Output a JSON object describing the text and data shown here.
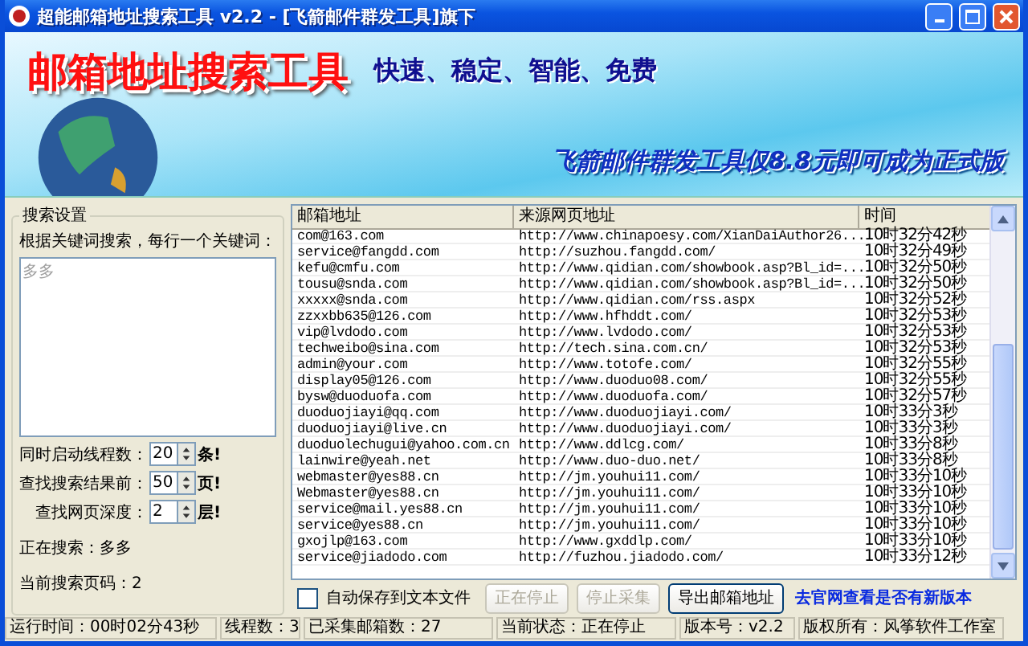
{
  "window": {
    "title": "超能邮箱地址搜索工具 v2.2 - [飞箭邮件群发工具]旗下"
  },
  "banner": {
    "title": "邮箱地址搜索工具",
    "slogan": "快速、稳定、智能、免费",
    "promo": "飞箭邮件群发工具仅8.8元即可成为正式版"
  },
  "search_settings": {
    "legend": "搜索设置",
    "keywords_label": "根据关键词搜索，每行一个关键词：",
    "keywords": "多多",
    "spinners": [
      {
        "label": "同时启动线程数：",
        "value": "20",
        "unit": "条!"
      },
      {
        "label": "查找搜索结果前：",
        "value": "50",
        "unit": "页!"
      },
      {
        "label": "查找网页深度：",
        "value": "2",
        "unit": "层!"
      }
    ],
    "searching": "正在搜索：多多",
    "current_page": "当前搜索页码：2"
  },
  "table": {
    "columns": [
      "邮箱地址",
      "来源网页地址",
      "时间"
    ],
    "rows": [
      [
        "com@163.com",
        "http://www.chinapoesy.com/XianDaiAuthor26...",
        "10时32分42秒"
      ],
      [
        "service@fangdd.com",
        "http://suzhou.fangdd.com/",
        "10时32分49秒"
      ],
      [
        "kefu@cmfu.com",
        "http://www.qidian.com/showbook.asp?Bl_id=...",
        "10时32分50秒"
      ],
      [
        "tousu@snda.com",
        "http://www.qidian.com/showbook.asp?Bl_id=...",
        "10时32分50秒"
      ],
      [
        "xxxxx@snda.com",
        "http://www.qidian.com/rss.aspx",
        "10时32分52秒"
      ],
      [
        "zzxxbb635@126.com",
        "http://www.hfhddt.com/",
        "10时32分53秒"
      ],
      [
        "vip@lvdodo.com",
        "http://www.lvdodo.com/",
        "10时32分53秒"
      ],
      [
        "techweibo@sina.com",
        "http://tech.sina.com.cn/",
        "10时32分53秒"
      ],
      [
        "admin@your.com",
        "http://www.totofe.com/",
        "10时32分55秒"
      ],
      [
        "display05@126.com",
        "http://www.duoduo08.com/",
        "10时32分55秒"
      ],
      [
        "bysw@duoduofa.com",
        "http://www.duoduofa.com/",
        "10时32分57秒"
      ],
      [
        "duoduojiayi@qq.com",
        "http://www.duoduojiayi.com/",
        "10时33分3秒"
      ],
      [
        "duoduojiayi@live.cn",
        "http://www.duoduojiayi.com/",
        "10时33分3秒"
      ],
      [
        "duoduolechugui@yahoo.com.cn",
        "http://www.ddlcg.com/",
        "10时33分8秒"
      ],
      [
        "lainwire@yeah.net",
        "http://www.duo-duo.net/",
        "10时33分8秒"
      ],
      [
        "webmaster@yes88.cn",
        "http://jm.youhui11.com/",
        "10时33分10秒"
      ],
      [
        "Webmaster@yes88.cn",
        "http://jm.youhui11.com/",
        "10时33分10秒"
      ],
      [
        "service@mail.yes88.cn",
        "http://jm.youhui11.com/",
        "10时33分10秒"
      ],
      [
        "service@yes88.cn",
        "http://jm.youhui11.com/",
        "10时33分10秒"
      ],
      [
        "gxojlp@163.com",
        "http://www.gxddlp.com/",
        "10时33分10秒"
      ],
      [
        "service@jiadodo.com",
        "http://fuzhou.jiadodo.com/",
        "10时33分12秒"
      ]
    ]
  },
  "auto_save": {
    "label": "自动保存到文本文件",
    "checked": false
  },
  "buttons": [
    {
      "label": "正在停止",
      "disabled": true
    },
    {
      "label": "停止采集",
      "disabled": true
    },
    {
      "label": "导出邮箱地址",
      "disabled": false
    }
  ],
  "link": "去官网查看是否有新版本",
  "status_bar": [
    "运行时间：00时02分43秒",
    "线程数：3",
    "已采集邮箱数：27",
    "当前状态：正在停止",
    "版本号：v2.2",
    "版权所有：风筝软件工作室"
  ]
}
